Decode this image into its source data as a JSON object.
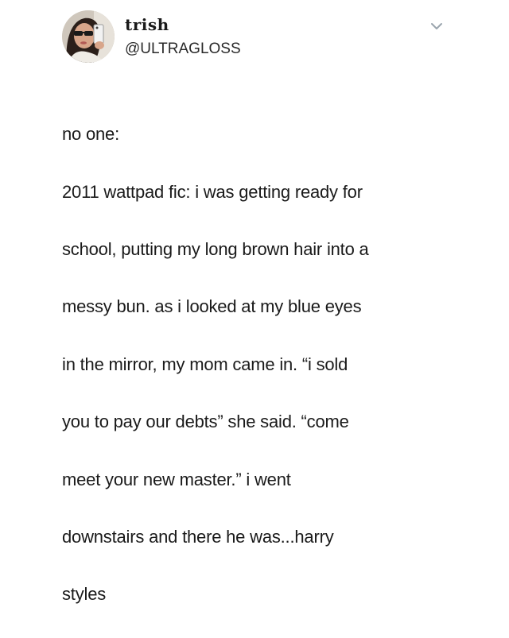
{
  "tweet": {
    "display_name": "trish",
    "handle": "@ULTRAGLOSS",
    "text_lines": [
      "no one:",
      "2011 wattpad fic: i was getting ready for",
      "school, putting my long brown hair into a",
      "messy bun. as i looked at my blue eyes",
      "in the mirror, my mom came in. “i sold",
      "you to pay our debts” she said. “come",
      "meet your new master.” i went",
      "downstairs and there he was...harry",
      "styles"
    ],
    "icons": {
      "avatar": "profile-photo",
      "caret": "chevron-down-icon"
    }
  }
}
